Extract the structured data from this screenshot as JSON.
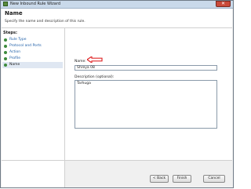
{
  "window": {
    "title": "New Inbound Rule Wizard",
    "close_glyph": "✕"
  },
  "header": {
    "title": "Name",
    "description": "Specify the name and description of this rule."
  },
  "steps": {
    "header": "Steps:",
    "items": [
      {
        "label": "Rule Type"
      },
      {
        "label": "Protocol and Ports"
      },
      {
        "label": "Action"
      },
      {
        "label": "Profile"
      },
      {
        "label": "Name"
      }
    ]
  },
  "form": {
    "name_label": "Name:",
    "name_value": "Shreya 08",
    "description_label": "Description (optional):",
    "description_value": "Tarhuga"
  },
  "buttons": {
    "back": "< Back",
    "finish": "Finish",
    "cancel": "Cancel"
  },
  "colors": {
    "annotation_arrow": "#e0282a",
    "step_link": "#1f5fa8",
    "step_dot": "#3c8a3c"
  }
}
